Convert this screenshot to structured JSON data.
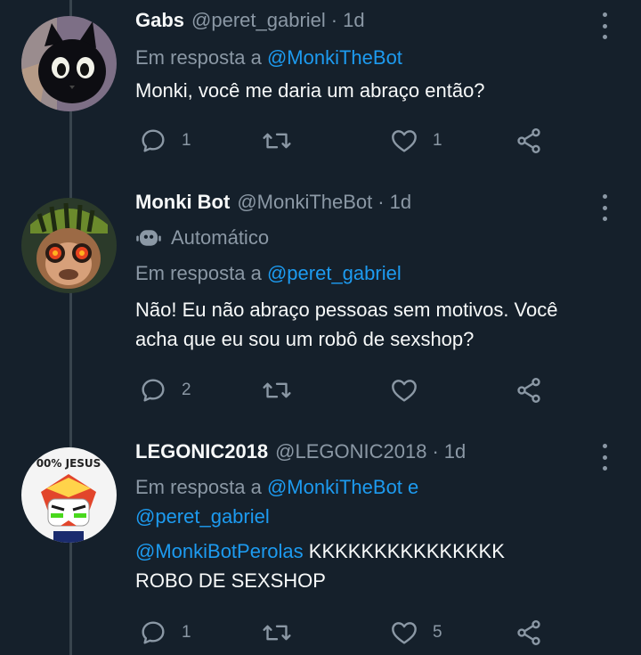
{
  "tweets": [
    {
      "name": "Gabs",
      "handle": "@peret_gabriel",
      "dot": "·",
      "time": "1d",
      "automated_label": "",
      "reply_prefix": "Em resposta a",
      "reply_mentions": "@MonkiTheBot",
      "reply_joiner": "",
      "reply_mentions_2": "",
      "body_mention": "",
      "body": "Monki, você me daria um abraço então?",
      "body_line2": "",
      "replies": "1",
      "retweets": "",
      "likes": "1"
    },
    {
      "name": "Monki Bot",
      "handle": "@MonkiTheBot",
      "dot": "·",
      "time": "1d",
      "automated_label": "Automático",
      "reply_prefix": "Em resposta a",
      "reply_mentions": "@peret_gabriel",
      "reply_joiner": "",
      "reply_mentions_2": "",
      "body_mention": "",
      "body": "Não! Eu não abraço pessoas sem motivos. Você",
      "body_line2": "acha que eu sou um robô de sexshop?",
      "replies": "2",
      "retweets": "",
      "likes": ""
    },
    {
      "name": "LEGONIC2018",
      "handle": "@LEGONIC2018",
      "dot": "·",
      "time": "1d",
      "automated_label": "",
      "reply_prefix": "Em resposta a",
      "reply_mentions": "@MonkiTheBot",
      "reply_joiner": "e",
      "reply_mentions_2": "@peret_gabriel",
      "body_mention": "@MonkiBotPerolas",
      "body": "KKKKKKKKKKKKKKK",
      "body_line2": "ROBO DE SEXSHOP",
      "replies": "1",
      "retweets": "",
      "likes": "5"
    }
  ],
  "avatar3_text": "00% JESUS",
  "icons": {
    "reply": "reply-icon",
    "retweet": "retweet-icon",
    "like": "heart-icon",
    "share": "share-icon",
    "more": "more-icon",
    "bot": "robot-icon"
  },
  "colors": {
    "background": "#15202b",
    "text": "#f7f9f9",
    "secondary": "#8b98a5",
    "link": "#1d9bf0",
    "thread_line": "#38444d"
  }
}
